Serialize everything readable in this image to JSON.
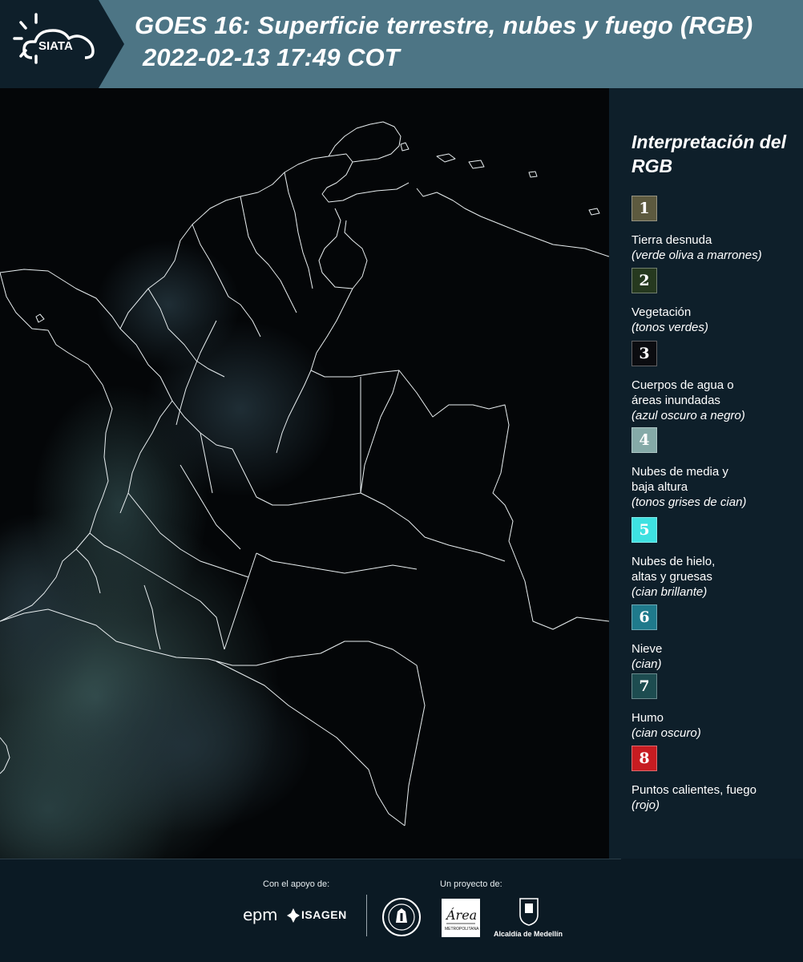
{
  "header": {
    "logo_text": "SIATA",
    "title_line1": "GOES 16: Superficie terrestre, nubes y fuego (RGB)",
    "title_line2": "2022-02-13 17:49 COT"
  },
  "map": {
    "icon": "map-satellite-image"
  },
  "legend": {
    "title": "Interpretación del RGB",
    "items": [
      {
        "number": "1",
        "label": "Tierra desnuda",
        "sub": "(verde oliva a marrones)",
        "color": "#5d5a3f"
      },
      {
        "number": "2",
        "label": "Vegetación",
        "sub": "(tonos verdes)",
        "color": "#26391f"
      },
      {
        "number": "3",
        "label": "Cuerpos de agua o\náreas inundadas",
        "sub": "(azul oscuro a negro)",
        "color": "#0b0c10"
      },
      {
        "number": "4",
        "label": "Nubes de media y\nbaja altura",
        "sub": "(tonos grises de cian)",
        "color": "#85aaa8"
      },
      {
        "number": "5",
        "label": "Nubes de hielo,\naltas y gruesas",
        "sub": "(cian brillante)",
        "color": "#3ee1e1"
      },
      {
        "number": "6",
        "label": "Nieve",
        "sub": "(cian)",
        "color": "#1f7a8c"
      },
      {
        "number": "7",
        "label": "Humo",
        "sub": "(cian oscuro)",
        "color": "#1d4c50"
      },
      {
        "number": "8",
        "label": "Puntos calientes, fuego",
        "sub": "(rojo)",
        "color": "#c71c21"
      }
    ]
  },
  "footer": {
    "support_caption": "Con el apoyo de:",
    "project_caption": "Un proyecto de:",
    "sponsors": [
      {
        "name": "epm",
        "icon": "epm-logo"
      },
      {
        "name": "ISAGEN",
        "icon": "isagen-logo"
      }
    ],
    "partners": [
      {
        "name": "Universidad EAFIT",
        "icon": "university-seal-logo"
      },
      {
        "name": "Área Metropolitana Valle de Aburrá",
        "icon": "area-metropolitana-logo"
      },
      {
        "name": "Alcaldía de Medellín",
        "icon": "alcaldia-medellin-logo"
      }
    ]
  }
}
